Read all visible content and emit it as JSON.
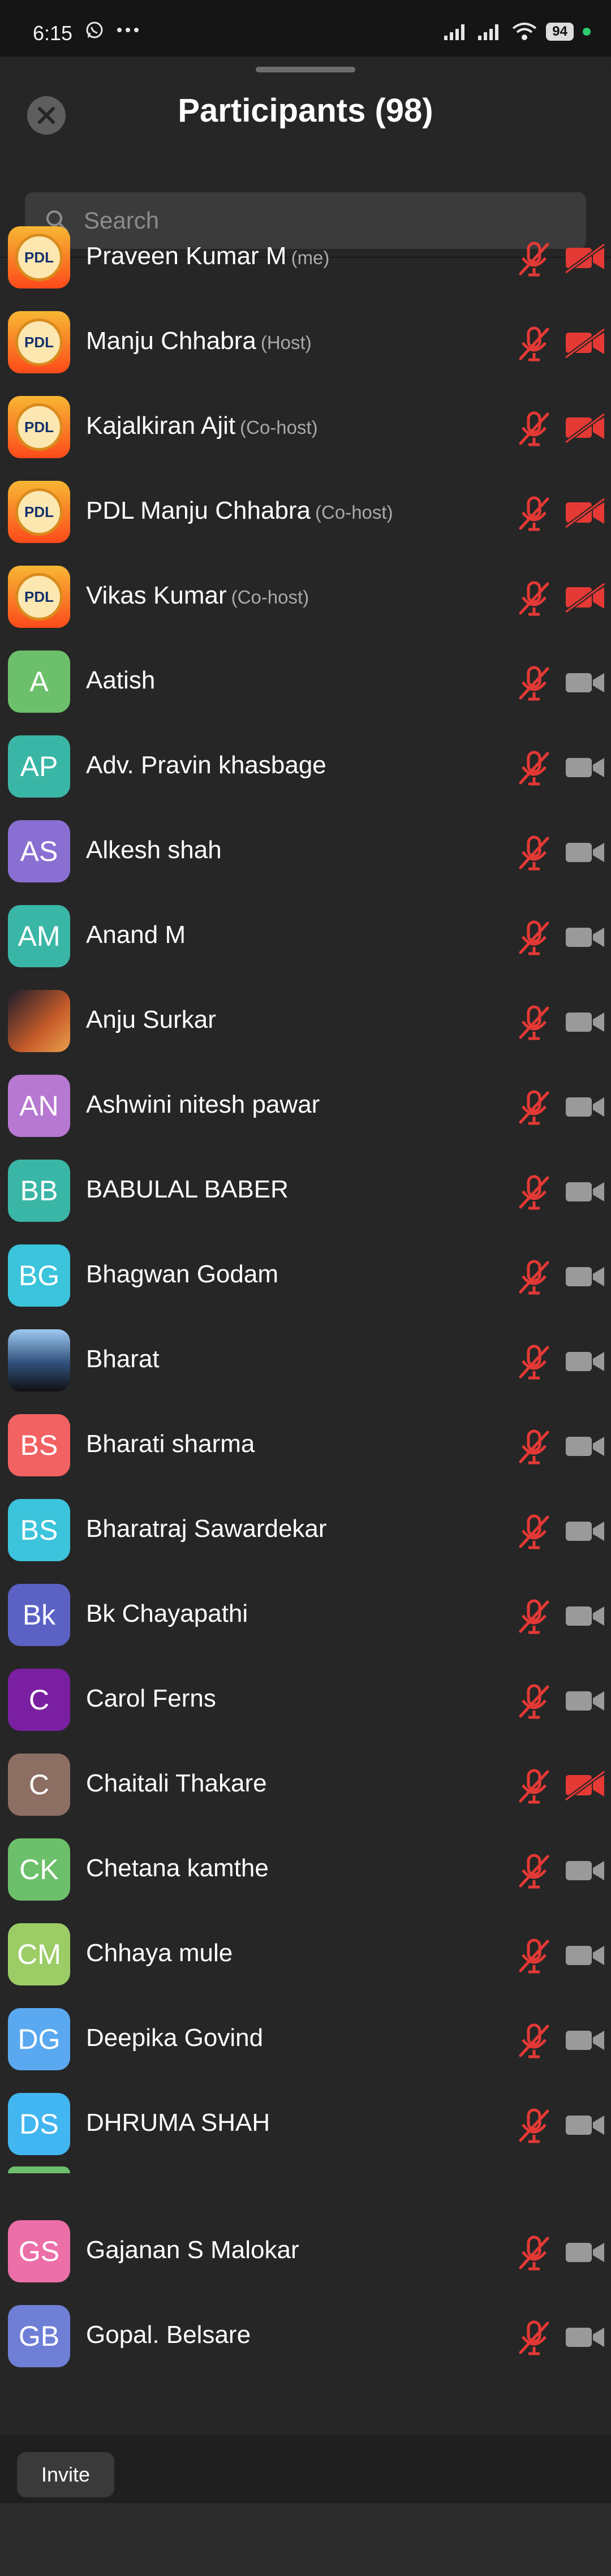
{
  "status_bar": {
    "time": "6:15",
    "battery": "94"
  },
  "header": {
    "title": "Participants (98)"
  },
  "search": {
    "placeholder": "Search"
  },
  "participants": [
    {
      "name": "Praveen Kumar M",
      "role": "(me)",
      "initials": "",
      "avatar": "logo",
      "video": "off"
    },
    {
      "name": "Manju Chhabra",
      "role": "(Host)",
      "initials": "",
      "avatar": "logo",
      "video": "off"
    },
    {
      "name": "Kajalkiran Ajit",
      "role": "(Co-host)",
      "initials": "",
      "avatar": "logo",
      "video": "off"
    },
    {
      "name": "PDL Manju Chhabra",
      "role": "(Co-host)",
      "initials": "",
      "avatar": "logo",
      "video": "off"
    },
    {
      "name": "Vikas Kumar",
      "role": "(Co-host)",
      "initials": "",
      "avatar": "logo",
      "video": "off"
    },
    {
      "name": "Aatish",
      "role": "",
      "initials": "A",
      "avatar": "#6dc06b",
      "video": "on"
    },
    {
      "name": "Adv. Pravin khasbage",
      "role": "",
      "initials": "AP",
      "avatar": "#3ab6a6",
      "video": "on"
    },
    {
      "name": "Alkesh shah",
      "role": "",
      "initials": "AS",
      "avatar": "#8a6fd3",
      "video": "on"
    },
    {
      "name": "Anand M",
      "role": "",
      "initials": "AM",
      "avatar": "#3ab6a6",
      "video": "on"
    },
    {
      "name": "Anju Surkar",
      "role": "",
      "initials": "",
      "avatar": "photo1",
      "video": "on"
    },
    {
      "name": "Ashwini nitesh pawar",
      "role": "",
      "initials": "AN",
      "avatar": "#b678d1",
      "video": "on"
    },
    {
      "name": "BABULAL BABER",
      "role": "",
      "initials": "BB",
      "avatar": "#3ab6a6",
      "video": "on"
    },
    {
      "name": "Bhagwan Godam",
      "role": "",
      "initials": "BG",
      "avatar": "#3cc4dc",
      "video": "on"
    },
    {
      "name": "Bharat",
      "role": "",
      "initials": "",
      "avatar": "photo2",
      "video": "on"
    },
    {
      "name": "Bharati sharma",
      "role": "",
      "initials": "BS",
      "avatar": "#f26262",
      "video": "on"
    },
    {
      "name": "Bharatraj Sawardekar",
      "role": "",
      "initials": "BS",
      "avatar": "#3cc4dc",
      "video": "on"
    },
    {
      "name": "Bk Chayapathi",
      "role": "",
      "initials": "Bk",
      "avatar": "#5b62c4",
      "video": "on"
    },
    {
      "name": "Carol Ferns",
      "role": "",
      "initials": "C",
      "avatar": "#7b1fa2",
      "video": "on"
    },
    {
      "name": "Chaitali Thakare",
      "role": "",
      "initials": "C",
      "avatar": "#8d6e63",
      "video": "off"
    },
    {
      "name": "Chetana kamthe",
      "role": "",
      "initials": "CK",
      "avatar": "#6dc06b",
      "video": "on"
    },
    {
      "name": "Chhaya mule",
      "role": "",
      "initials": "CM",
      "avatar": "#9ccc65",
      "video": "on"
    },
    {
      "name": "Deepika Govind",
      "role": "",
      "initials": "DG",
      "avatar": "#5aa9f0",
      "video": "on"
    },
    {
      "name": "DHRUMA SHAH",
      "role": "",
      "initials": "DS",
      "avatar": "#42b6f0",
      "video": "on"
    },
    {
      "name": "Gajanan S Malokar",
      "role": "",
      "initials": "GS",
      "avatar": "#ec6fa8",
      "video": "on"
    },
    {
      "name": "Gopal. Belsare",
      "role": "",
      "initials": "GB",
      "avatar": "#6f7fd6",
      "video": "on"
    }
  ],
  "colors": {
    "muted_red": "#e53935",
    "video_on_gray": "#9a9a9a"
  },
  "footer": {
    "invite_label": "Invite"
  }
}
